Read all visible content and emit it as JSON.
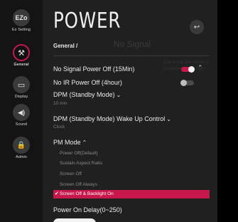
{
  "sidebar": {
    "items": [
      {
        "label": "Ez Setting",
        "icon_text": "EZo",
        "icon": "ez-setting-icon"
      },
      {
        "label": "General",
        "icon_text": "⚒",
        "icon": "general-wrench-icon",
        "active": true
      },
      {
        "label": "Display",
        "icon_text": "▭",
        "icon": "display-monitor-icon"
      },
      {
        "label": "Sound",
        "icon_text": "◀)",
        "icon": "sound-speaker-icon"
      },
      {
        "label": "Admin",
        "icon_text": "🔒",
        "icon": "admin-lock-icon"
      }
    ]
  },
  "header": {
    "title": "POWER",
    "breadcrumb": "General /",
    "back_icon": "↩"
  },
  "background_ghost": {
    "no_signal": "No Signal",
    "message": "Check that the device is connected to the input"
  },
  "settings": {
    "no_signal_power_off": {
      "label": "No Signal Power Off (15Min)",
      "enabled": true
    },
    "no_ir_power_off": {
      "label": "No IR Power Off (4hour)",
      "enabled": false
    },
    "dpm": {
      "label": "DPM (Standby Mode)",
      "chevron": "⌄",
      "value": "10 min"
    },
    "dpm_wakeup": {
      "label": "DPM (Standby Mode) Wake Up Control",
      "chevron": "⌄",
      "value": "Clock"
    },
    "pm_mode": {
      "label": "PM Mode",
      "chevron": "⌃",
      "options": [
        "Power Off(Default)",
        "Sustain Aspect Ratio",
        "Screen Off",
        "Screen Off Always"
      ],
      "selected": "Screen Off & Backlight On",
      "check": "✔"
    },
    "power_on_delay": {
      "label": "Power On Delay(0~250)"
    }
  },
  "colors": {
    "accent": "#c8174b",
    "panel": "#202020",
    "sidebar": "#141414"
  }
}
